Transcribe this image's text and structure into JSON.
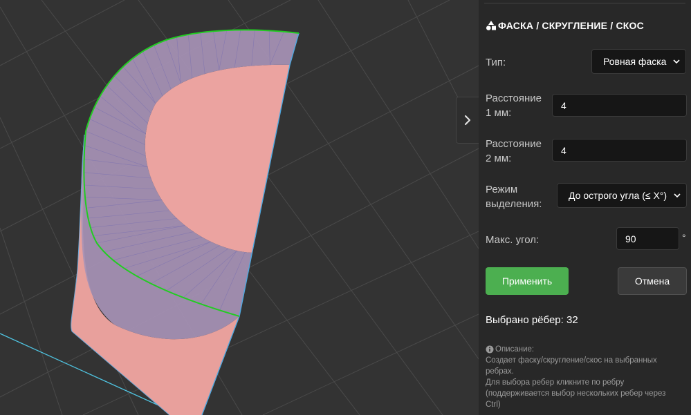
{
  "panel": {
    "title": "ФАСКА / СКРУГЛЕНИЕ / СКОС",
    "type_label": "Тип:",
    "type_value": "Ровная фаска",
    "dist1_label_line1": "Расстояние",
    "dist1_label_line2": "1 мм:",
    "dist1_value": "4",
    "dist2_label_line1": "Расстояние",
    "dist2_label_line2": "2 мм:",
    "dist2_value": "4",
    "mode_label_line1": "Режим",
    "mode_label_line2": "выделения:",
    "mode_value": "До острого угла (≤ X°)",
    "max_angle_label": "Макс. угол:",
    "max_angle_value": "90",
    "max_angle_unit": "°",
    "apply_label": "Применить",
    "cancel_label": "Отмена",
    "selected_count": "Выбрано рёбер: 32",
    "desc_title": "Описание:",
    "desc_line1": "Создает фаску/скругление/скос на выбранных",
    "desc_line2": "ребрах.",
    "desc_line3": "Для выбора ребер кликните по ребру",
    "desc_line4": "(поддерживается выбор нескольких ребер через",
    "desc_line5": "Ctrl)"
  },
  "colors": {
    "accent_green": "#4caf50",
    "selected_edge": "#22cc22",
    "model_face": "#e8a09c",
    "chamfer_band": "#a78fb2",
    "axis_line": "#4fc3e0"
  },
  "icons": {
    "title_icon": "shapes-icon",
    "toggle_icon": "chevron-right-icon",
    "info_icon": "info-icon",
    "select_arrow": "chevron-down-icon"
  }
}
